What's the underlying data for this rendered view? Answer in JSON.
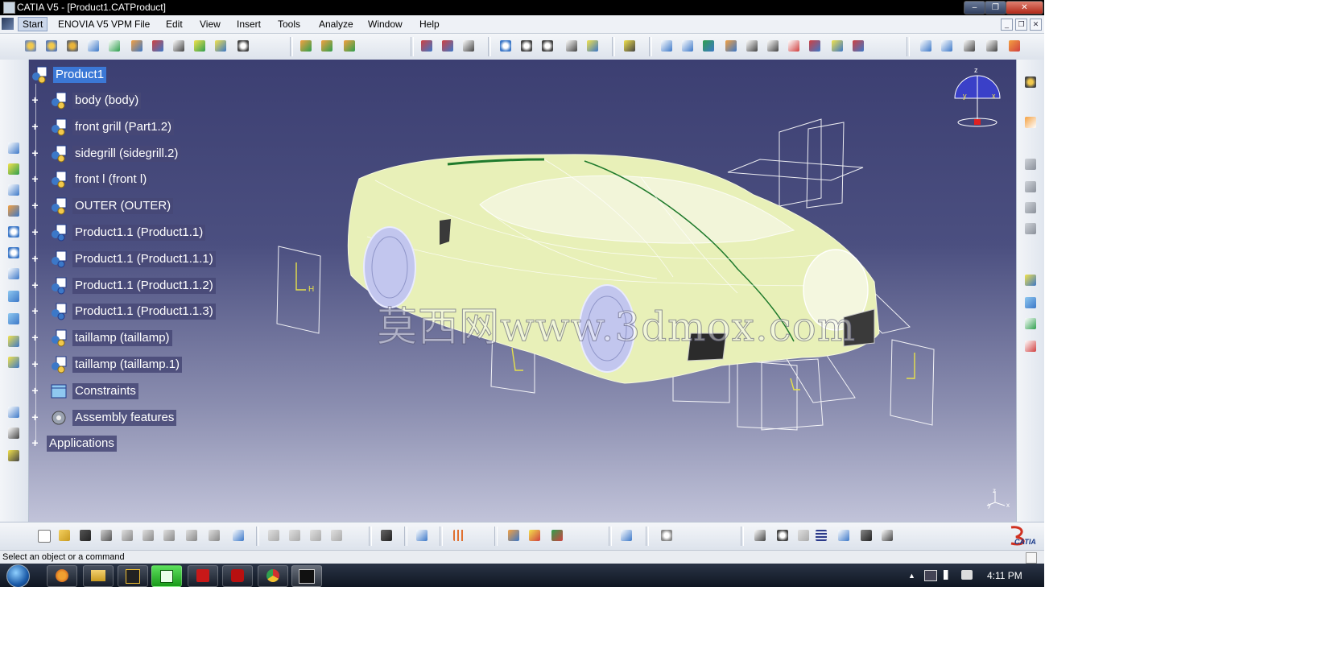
{
  "window": {
    "title": "CATIA V5 - [Product1.CATProduct]",
    "min_glyph": "–",
    "restore_glyph": "❐",
    "close_glyph": "✕"
  },
  "menubar": {
    "items": [
      "Start",
      "ENOVIA V5 VPM",
      "File",
      "Edit",
      "View",
      "Insert",
      "Tools",
      "Analyze",
      "Window",
      "Help"
    ],
    "mdi": {
      "min": "_",
      "restore": "❐",
      "close": "✕"
    }
  },
  "tree": {
    "root": "Product1",
    "nodes": [
      {
        "label": "body (body)",
        "icon": "part-icon"
      },
      {
        "label": "front grill (Part1.2)",
        "icon": "part-icon"
      },
      {
        "label": "sidegrill (sidegrill.2)",
        "icon": "part-icon"
      },
      {
        "label": "front l (front l)",
        "icon": "part-icon"
      },
      {
        "label": "OUTER (OUTER)",
        "icon": "part-icon"
      },
      {
        "label": "Product1.1 (Product1.1)",
        "icon": "product-icon"
      },
      {
        "label": "Product1.1 (Product1.1.1)",
        "icon": "product-icon"
      },
      {
        "label": "Product1.1 (Product1.1.2)",
        "icon": "product-icon"
      },
      {
        "label": "Product1.1 (Product1.1.3)",
        "icon": "product-icon"
      },
      {
        "label": "taillamp (taillamp)",
        "icon": "part-icon"
      },
      {
        "label": "taillamp (taillamp.1)",
        "icon": "part-icon"
      },
      {
        "label": "Constraints",
        "icon": "constraints-icon"
      },
      {
        "label": "Assembly features",
        "icon": "assembly-features-icon"
      },
      {
        "label": "Applications",
        "icon": ""
      }
    ]
  },
  "viewport": {
    "watermark": "莫西网www.3dmox.com",
    "compass_labels": {
      "z": "z",
      "y": "y",
      "x": "x"
    },
    "axis_labels": {
      "z": "z",
      "y": "y",
      "x": "x"
    },
    "plane_label": "H"
  },
  "status": {
    "text": "Select an object or a command"
  },
  "taskbar": {
    "time": "4:11 PM",
    "apps": [
      "start-orb",
      "firefox",
      "explorer",
      "autocad",
      "catia-green",
      "acrobat",
      "mcafee",
      "chrome",
      "catia-window"
    ]
  },
  "brand": {
    "logo_text": "CATIA"
  },
  "colors": {
    "viewport_top": "#3c3f72",
    "viewport_bottom": "#c1c3d9",
    "selection": "#3b78d6",
    "car_body": "#e8f0b8"
  }
}
